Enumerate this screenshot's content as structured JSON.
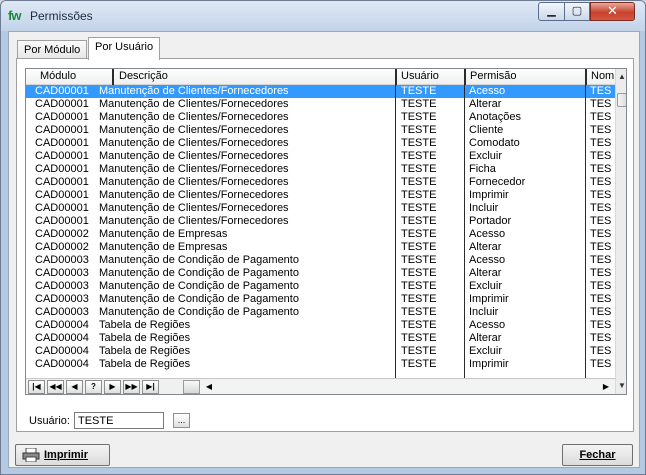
{
  "window": {
    "title": "Permissões",
    "app_icon": "fw",
    "minimize": "minimize-icon",
    "maximize": "maximize-icon",
    "close": "close-icon"
  },
  "tabs": [
    {
      "label": "Por Módulo",
      "active": false
    },
    {
      "label": "Por Usuário",
      "active": true
    }
  ],
  "grid": {
    "columns": [
      "Módulo",
      "Descrição",
      "Usuário",
      "Permisão",
      "Nom"
    ],
    "rows": [
      [
        "CAD00001",
        "Manutenção de Clientes/Fornecedores",
        "TESTE",
        "Acesso",
        "TES"
      ],
      [
        "CAD00001",
        "Manutenção de Clientes/Fornecedores",
        "TESTE",
        "Alterar",
        "TES"
      ],
      [
        "CAD00001",
        "Manutenção de Clientes/Fornecedores",
        "TESTE",
        "Anotações",
        "TES"
      ],
      [
        "CAD00001",
        "Manutenção de Clientes/Fornecedores",
        "TESTE",
        "Cliente",
        "TES"
      ],
      [
        "CAD00001",
        "Manutenção de Clientes/Fornecedores",
        "TESTE",
        "Comodato",
        "TES"
      ],
      [
        "CAD00001",
        "Manutenção de Clientes/Fornecedores",
        "TESTE",
        "Excluir",
        "TES"
      ],
      [
        "CAD00001",
        "Manutenção de Clientes/Fornecedores",
        "TESTE",
        "Ficha",
        "TES"
      ],
      [
        "CAD00001",
        "Manutenção de Clientes/Fornecedores",
        "TESTE",
        "Fornecedor",
        "TES"
      ],
      [
        "CAD00001",
        "Manutenção de Clientes/Fornecedores",
        "TESTE",
        "Imprimir",
        "TES"
      ],
      [
        "CAD00001",
        "Manutenção de Clientes/Fornecedores",
        "TESTE",
        "Incluir",
        "TES"
      ],
      [
        "CAD00001",
        "Manutenção de Clientes/Fornecedores",
        "TESTE",
        "Portador",
        "TES"
      ],
      [
        "CAD00002",
        "Manutenção de Empresas",
        "TESTE",
        "Acesso",
        "TES"
      ],
      [
        "CAD00002",
        "Manutenção de Empresas",
        "TESTE",
        "Alterar",
        "TES"
      ],
      [
        "CAD00003",
        "Manutenção de Condição de Pagamento",
        "TESTE",
        "Acesso",
        "TES"
      ],
      [
        "CAD00003",
        "Manutenção de Condição de Pagamento",
        "TESTE",
        "Alterar",
        "TES"
      ],
      [
        "CAD00003",
        "Manutenção de Condição de Pagamento",
        "TESTE",
        "Excluir",
        "TES"
      ],
      [
        "CAD00003",
        "Manutenção de Condição de Pagamento",
        "TESTE",
        "Imprimir",
        "TES"
      ],
      [
        "CAD00003",
        "Manutenção de Condição de Pagamento",
        "TESTE",
        "Incluir",
        "TES"
      ],
      [
        "CAD00004",
        "Tabela de Regiões",
        "TESTE",
        "Acesso",
        "TES"
      ],
      [
        "CAD00004",
        "Tabela de Regiões",
        "TESTE",
        "Alterar",
        "TES"
      ],
      [
        "CAD00004",
        "Tabela de Regiões",
        "TESTE",
        "Excluir",
        "TES"
      ],
      [
        "CAD00004",
        "Tabela de Regiões",
        "TESTE",
        "Imprimir",
        "TES"
      ]
    ],
    "selected_row": 0
  },
  "navigator": {
    "buttons": [
      "|◀",
      "◀◀",
      "◀",
      "?",
      "▶",
      "▶▶",
      "▶|"
    ]
  },
  "user_filter": {
    "label": "Usuário:",
    "value": "TESTE",
    "lookup_button": "..."
  },
  "footer": {
    "print_label": "Imprimir",
    "close_label": "Fechar"
  },
  "colors": {
    "selection": "#3399ff",
    "window_frame": "#b6c9e2",
    "close_button": "#c7432f"
  }
}
